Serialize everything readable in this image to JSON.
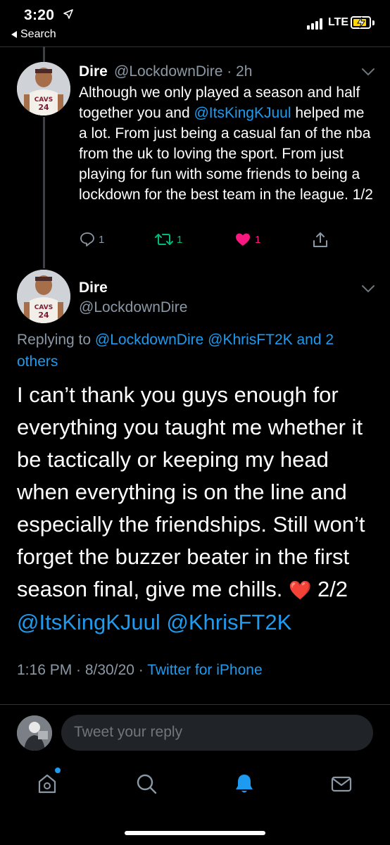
{
  "status_bar": {
    "time": "3:20",
    "back_label": "Search",
    "network": "LTE"
  },
  "parent_tweet": {
    "name": "Dire",
    "handle": "@LockdownDire",
    "time_ago": "· 2h",
    "text_part1": "Although we only played a season and half together you and ",
    "mention": "@ItsKingKJuul",
    "text_part2": " helped me a lot. From just being a casual fan of the nba from the uk to loving the sport. From just playing for fun with some friends to being a lockdown for the best team in the league. 1/2",
    "reply_count": "1",
    "retweet_count": "1",
    "like_count": "1"
  },
  "main_tweet": {
    "name": "Dire",
    "handle": "@LockdownDire",
    "replying_prefix": "Replying to ",
    "replying_mentions": "@LockdownDire @KhrisFT2K",
    "replying_suffix": " and 2 others",
    "text": "I can’t thank you guys enough for everything you taught me whether it be tactically or keeping my head when everything is on the line and especially the friendships. Still won’t forget the buzzer beater in the first season final, give me chills. ",
    "heart_emoji": "❤️",
    "text_end": " 2/2",
    "trailing_mentions": "@ItsKingKJuul @KhrisFT2K",
    "timestamp": "1:16 PM · 8/30/20 · ",
    "source": "Twitter for iPhone"
  },
  "reply_bar": {
    "placeholder": "Tweet your reply"
  },
  "tab_bar": {
    "items": [
      "home-icon",
      "search-icon",
      "notifications-icon",
      "messages-icon"
    ],
    "active": "notifications-icon"
  },
  "colors": {
    "accent": "#1d9bf0",
    "like": "#f91880",
    "retweet": "#00ba7c",
    "background": "#000000",
    "muted": "#8b98a5"
  }
}
